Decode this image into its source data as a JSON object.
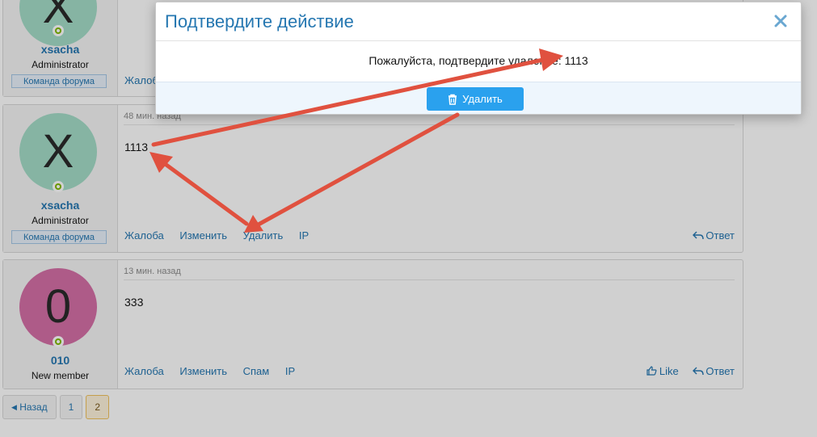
{
  "posts": [
    {
      "avatar_letter": "X",
      "avatar_color": "#a4dcc7",
      "username": "xsacha",
      "usertitle": "Administrator",
      "banner": "Команда форума",
      "actions_partial": "Жалоба"
    },
    {
      "avatar_letter": "X",
      "avatar_color": "#a4dcc7",
      "username": "xsacha",
      "usertitle": "Administrator",
      "banner": "Команда форума",
      "date": "48 мин. назад",
      "body": "1113",
      "actions": [
        "Жалоба",
        "Изменить",
        "Удалить",
        "IP"
      ],
      "reply": "Ответ"
    },
    {
      "avatar_letter": "0",
      "avatar_color": "#d56fa6",
      "username": "010",
      "usertitle": "New member",
      "date": "13 мин. назад",
      "body": "333",
      "actions": [
        "Жалоба",
        "Изменить",
        "Спам",
        "IP"
      ],
      "like": "Like",
      "reply": "Ответ"
    }
  ],
  "pager": {
    "prev": "Назад",
    "pages": [
      "1",
      "2"
    ],
    "current": "2"
  },
  "modal": {
    "title": "Подтвердите действие",
    "message": "Пожалуйста, подтвердите удаление: 1113",
    "delete_label": "Удалить"
  },
  "colors": {
    "accent": "#2577b1",
    "button": "#2aa1ee",
    "arrow": "#e0513f",
    "online": "#7fb900"
  },
  "icons": [
    "close-icon",
    "trash-icon",
    "reply-icon",
    "like-icon",
    "chevron-left-icon"
  ]
}
